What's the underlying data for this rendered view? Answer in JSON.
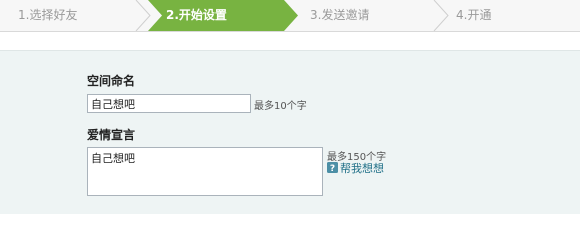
{
  "steps": [
    {
      "label": "1.选择好友",
      "active": false
    },
    {
      "label": "2.开始设置",
      "active": true
    },
    {
      "label": "3.发送邀请",
      "active": false
    },
    {
      "label": "4.开通",
      "active": false
    }
  ],
  "colors": {
    "active_step": "#78b341",
    "form_background": "#eef4f4",
    "link": "#1f6f87"
  },
  "form": {
    "space_name": {
      "label": "空间命名",
      "value": "自己想吧",
      "hint": "最多10个字"
    },
    "love_declaration": {
      "label": "爱情宣言",
      "value": "自己想吧",
      "hint": "最多150个字",
      "help_link": "帮我想想",
      "help_icon": "question-icon"
    }
  }
}
